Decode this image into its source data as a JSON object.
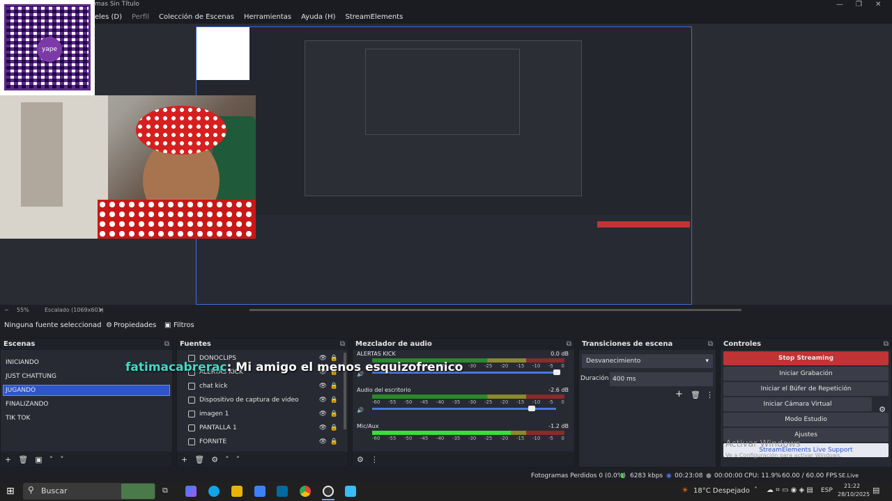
{
  "window": {
    "title": "mas Sin Título"
  },
  "menu": {
    "items": [
      "eles (D)",
      "Perfil",
      "Colección de Escenas",
      "Herramientas",
      "Ayuda (H)",
      "StreamElements"
    ]
  },
  "preview": {
    "zoom": "55%",
    "scale": "Escalado (1069x601)"
  },
  "overlay_chat": {
    "user": "fatimacabrerac",
    "message": ": Mi amigo el menos esquizofrenico"
  },
  "source_bar": {
    "none_selected": "Ninguna fuente seleccionad",
    "properties": "Propiedades",
    "filters": "Filtros"
  },
  "scenes": {
    "title": "Escenas",
    "items": [
      "INICIANDO",
      "JUST CHATTUNG",
      "JUGANDO",
      "FINALIZANDO",
      "TIK TOK"
    ],
    "selected": "JUGANDO"
  },
  "sources": {
    "title": "Fuentes",
    "items": [
      "DONOCLIPS",
      "ALERTAS KICK",
      "chat kick",
      "Dispositivo de captura de video",
      "imagen 1",
      "PANTALLA 1",
      "FORNITE"
    ]
  },
  "mixer": {
    "title": "Mezclador de audio",
    "channels": [
      {
        "name": "ALERTAS KICK",
        "db": "0.0 dB",
        "level": 0
      },
      {
        "name": "Audio del escritorio",
        "db": "-2.6 dB",
        "level": 0
      },
      {
        "name": "Mic/Aux",
        "db": "-1.2 dB",
        "level": 0.72
      }
    ],
    "ticks": [
      "-60",
      "-55",
      "-50",
      "-45",
      "-40",
      "-35",
      "-30",
      "-25",
      "-20",
      "-15",
      "-10",
      "-5",
      "0"
    ]
  },
  "transitions": {
    "title": "Transiciones de escena",
    "type": "Desvanecimiento",
    "duration_label": "Duración",
    "duration": "400 ms"
  },
  "controls": {
    "title": "Controles",
    "buttons": [
      "Stop Streaming",
      "Iniciar Grabación",
      "Iniciar el Búfer de Repetición",
      "Iniciar Cámara Virtual",
      "Modo Estudio",
      "Ajustes",
      "StreamElements Live Support"
    ]
  },
  "watermark": {
    "line1": "Activar Windows",
    "line2": "Ve a Configuración para activar Windows."
  },
  "status": {
    "dropped": "Fotogramas Perdidos 0 (0.0%)",
    "kbps": "6283 kbps",
    "live_time": "00:23:08",
    "rec_time": "00:00:00",
    "cpu": "CPU: 11.9%",
    "fps": "60.00 / 60.00 FPS",
    "version": "SE.Live 25.6.19.485"
  },
  "taskbar": {
    "search": "Buscar",
    "weather": "18°C Despejado",
    "lang": "ESP",
    "time": "21:22",
    "date": "28/10/2025"
  },
  "qr": {
    "brand": "yape"
  }
}
